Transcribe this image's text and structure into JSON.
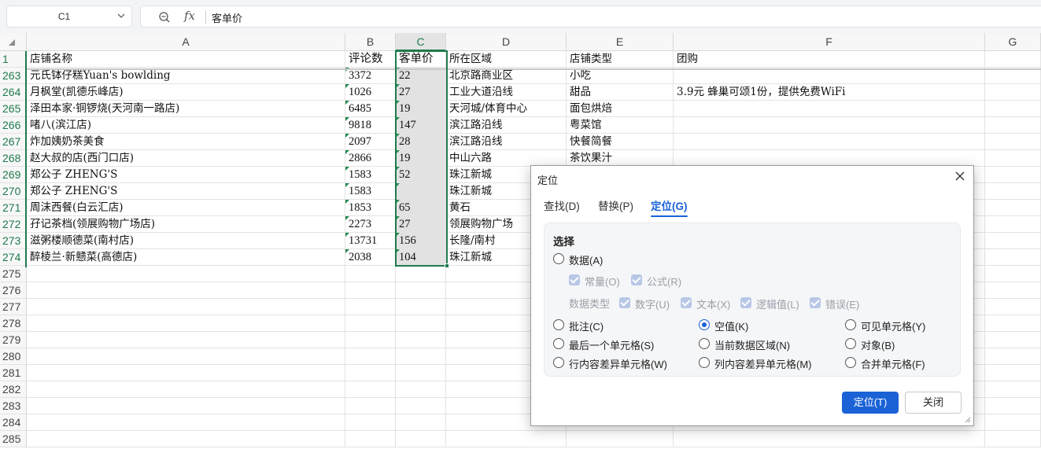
{
  "formula_bar": {
    "cell_ref": "C1",
    "formula": "客单价",
    "fx_label": "fx"
  },
  "columns": [
    "A",
    "B",
    "C",
    "D",
    "E",
    "F",
    "G"
  ],
  "rows": [
    {
      "num": "1",
      "a": "店铺名称",
      "b": "评论数",
      "c": "客单价",
      "d": "所在区域",
      "e": "店铺类型",
      "f": "团购"
    },
    {
      "num": "263",
      "a": "元氏钵仔糕Yuan's bowlding",
      "b": "3372",
      "c": "22",
      "d": "北京路商业区",
      "e": "小吃",
      "f": ""
    },
    {
      "num": "264",
      "a": "月枫堂(凯德乐峰店)",
      "b": "1026",
      "c": "27",
      "d": "工业大道沿线",
      "e": "甜品",
      "f": "3.9元 蜂巢可颂1份，提供免费WiFi"
    },
    {
      "num": "265",
      "a": "泽田本家·铜锣烧(天河南一路店)",
      "b": "6485",
      "c": "19",
      "d": "天河城/体育中心",
      "e": "面包烘焙",
      "f": ""
    },
    {
      "num": "266",
      "a": "啫八(滨江店)",
      "b": "9818",
      "c": "147",
      "d": "滨江路沿线",
      "e": "粤菜馆",
      "f": ""
    },
    {
      "num": "267",
      "a": "炸加姨奶茶美食",
      "b": "2097",
      "c": "28",
      "d": "滨江路沿线",
      "e": "快餐简餐",
      "f": ""
    },
    {
      "num": "268",
      "a": "赵大叔的店(西门口店)",
      "b": "2866",
      "c": "19",
      "d": "中山六路",
      "e": "茶饮果汁",
      "f": ""
    },
    {
      "num": "269",
      "a": "郑公子 ZHENG'S",
      "b": "1583",
      "c": "52",
      "d": "珠江新城",
      "e": "",
      "f": ""
    },
    {
      "num": "270",
      "a": "郑公子 ZHENG'S",
      "b": "1583",
      "c": "",
      "d": "珠江新城",
      "e": "",
      "f": ""
    },
    {
      "num": "271",
      "a": "周沫西餐(白云汇店)",
      "b": "1853",
      "c": "65",
      "d": "黄石",
      "e": "",
      "f": ""
    },
    {
      "num": "272",
      "a": "孖记茶档(领展购物广场店)",
      "b": "2273",
      "c": "27",
      "d": "领展购物广场",
      "e": "",
      "f": ""
    },
    {
      "num": "273",
      "a": "滋粥楼顺德菜(南村店)",
      "b": "13731",
      "c": "156",
      "d": "长隆/南村",
      "e": "",
      "f": ""
    },
    {
      "num": "274",
      "a": "醉棱兰·新戆菜(高德店)",
      "b": "2038",
      "c": "104",
      "d": "珠江新城",
      "e": "",
      "f": ""
    },
    {
      "num": "275",
      "a": "",
      "b": "",
      "c": "",
      "d": "",
      "e": "",
      "f": ""
    },
    {
      "num": "276",
      "a": "",
      "b": "",
      "c": "",
      "d": "",
      "e": "",
      "f": ""
    },
    {
      "num": "277",
      "a": "",
      "b": "",
      "c": "",
      "d": "",
      "e": "",
      "f": ""
    },
    {
      "num": "278",
      "a": "",
      "b": "",
      "c": "",
      "d": "",
      "e": "",
      "f": ""
    },
    {
      "num": "279",
      "a": "",
      "b": "",
      "c": "",
      "d": "",
      "e": "",
      "f": ""
    },
    {
      "num": "280",
      "a": "",
      "b": "",
      "c": "",
      "d": "",
      "e": "",
      "f": ""
    },
    {
      "num": "281",
      "a": "",
      "b": "",
      "c": "",
      "d": "",
      "e": "",
      "f": ""
    },
    {
      "num": "282",
      "a": "",
      "b": "",
      "c": "",
      "d": "",
      "e": "",
      "f": ""
    },
    {
      "num": "283",
      "a": "",
      "b": "",
      "c": "",
      "d": "",
      "e": "",
      "f": ""
    },
    {
      "num": "284",
      "a": "",
      "b": "",
      "c": "",
      "d": "",
      "e": "",
      "f": ""
    },
    {
      "num": "285",
      "a": "",
      "b": "",
      "c": "",
      "d": "",
      "e": "",
      "f": ""
    }
  ],
  "dialog": {
    "title": "定位",
    "tabs": [
      "查找(D)",
      "替换(P)",
      "定位(G)"
    ],
    "active_tab": "定位(G)",
    "section_title": "选择",
    "opt_data": "数据(A)",
    "sub_constant": "常量(O)",
    "sub_formula": "公式(R)",
    "data_type_label": "数据类型",
    "type_number": "数字(U)",
    "type_text": "文本(X)",
    "type_logic": "逻辑值(L)",
    "type_error": "错误(E)",
    "opt_comment": "批注(C)",
    "opt_blank": "空值(K)",
    "opt_visible": "可见单元格(Y)",
    "opt_last": "最后一个单元格(S)",
    "opt_region": "当前数据区域(N)",
    "opt_object": "对象(B)",
    "opt_row_diff": "行内容差异单元格(W)",
    "opt_col_diff": "列内容差异单元格(M)",
    "opt_merged": "合并单元格(F)",
    "selected_option": "空值(K)",
    "btn_locate": "定位(T)",
    "btn_close": "关闭"
  },
  "colors": {
    "accent": "#1a62d6",
    "selection": "#1f7a4d",
    "triangle": "#1f8a4c"
  }
}
